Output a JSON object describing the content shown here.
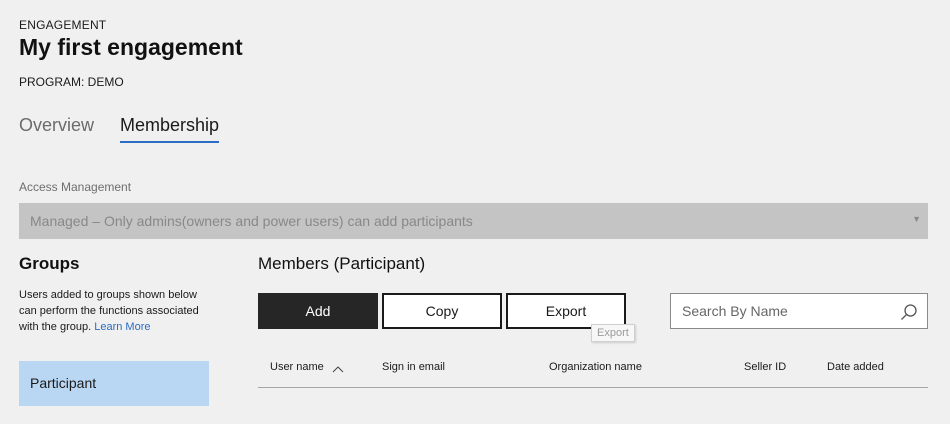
{
  "header": {
    "eyebrow": "ENGAGEMENT",
    "title": "My first engagement",
    "program": "PROGRAM: DEMO"
  },
  "tabs": [
    {
      "label": "Overview",
      "active": false
    },
    {
      "label": "Membership",
      "active": true
    }
  ],
  "access": {
    "label": "Access Management",
    "selected": "Managed – Only admins(owners and power users) can add participants"
  },
  "groups": {
    "title": "Groups",
    "description": "Users added to groups shown below can perform the functions associated with the group.",
    "learn_more": "Learn More",
    "items": [
      {
        "label": "Participant",
        "selected": true
      }
    ]
  },
  "members": {
    "title": "Members (Participant)",
    "add_label": "Add",
    "copy_label": "Copy",
    "export_label": "Export",
    "export_tooltip": "Export",
    "search_placeholder": "Search By Name",
    "columns": [
      "User name",
      "Sign in email",
      "Organization name",
      "Seller ID",
      "Date added"
    ]
  },
  "colors": {
    "accent": "#2b6cc4",
    "selected_group_bg": "#b9d7f2",
    "primary_button_bg": "#262626",
    "disabled_select_bg": "#c4c4c4"
  },
  "icons": [
    "search-icon",
    "sort-ascending-icon",
    "dropdown-caret-icon"
  ]
}
